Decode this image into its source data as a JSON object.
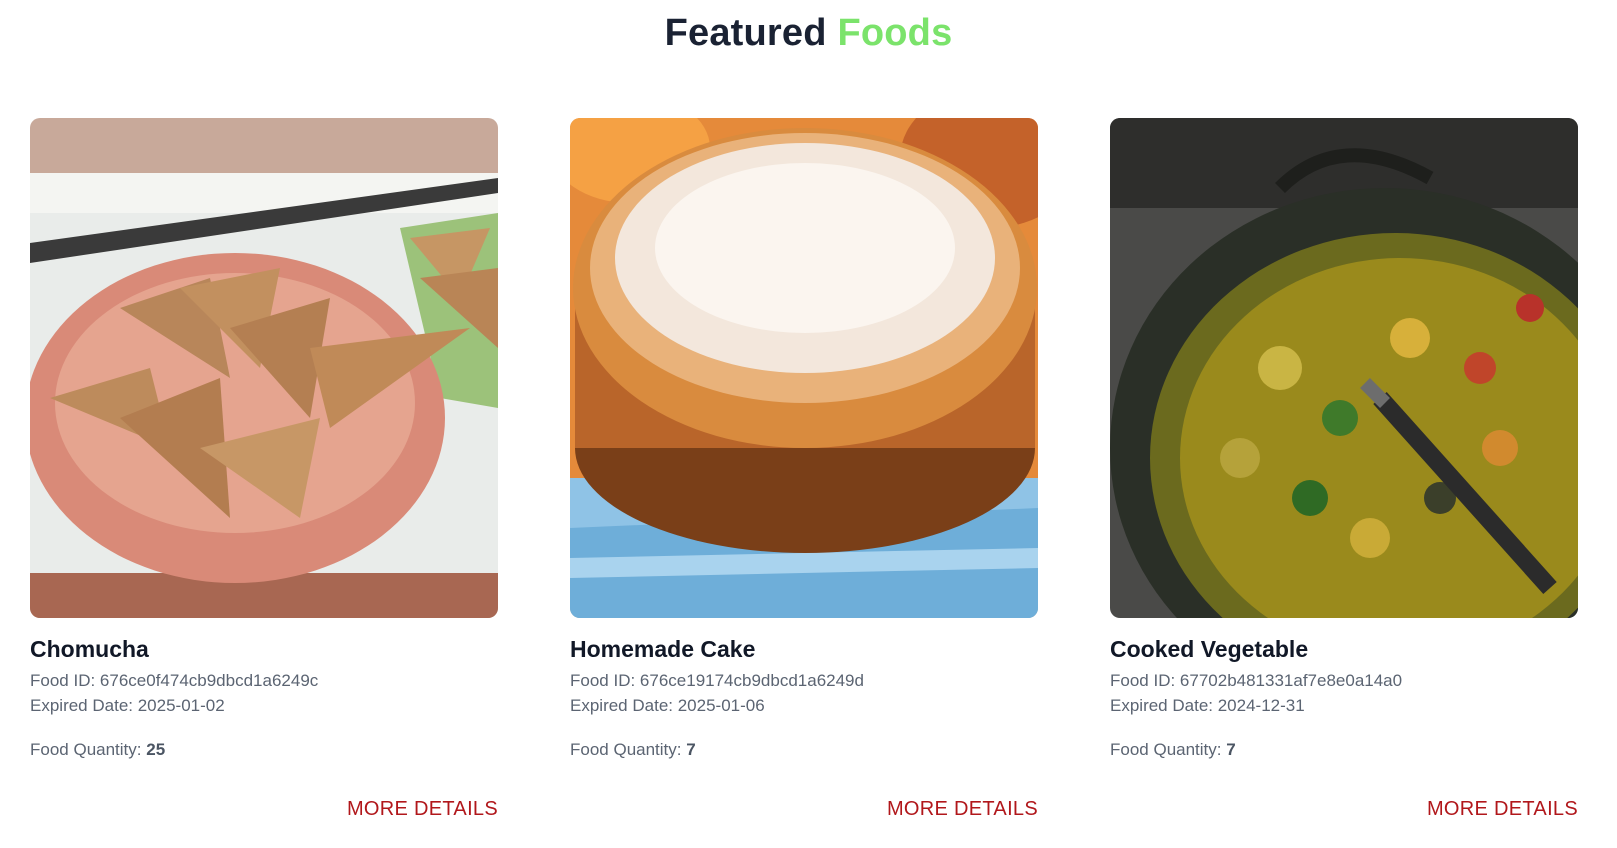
{
  "section": {
    "title_main": "Featured",
    "title_accent": "Foods",
    "accent_color": "#7be36b"
  },
  "foods": [
    {
      "name": "Chomucha",
      "id_label": "Food ID: 676ce0f474cb9dbcd1a6249c",
      "expired_label": "Expired Date: 2025-01-02",
      "quantity_label": "Food Quantity: ",
      "quantity_value": "25",
      "more_label": "MORE DETAILS",
      "image_icon": "samosa-bowl-photo"
    },
    {
      "name": "Homemade Cake",
      "id_label": "Food ID: 676ce19174cb9dbcd1a6249d",
      "expired_label": "Expired Date: 2025-01-06",
      "quantity_label": "Food Quantity: ",
      "quantity_value": "7",
      "more_label": "MORE DETAILS",
      "image_icon": "sponge-cake-photo"
    },
    {
      "name": "Cooked Vegetable",
      "id_label": "Food ID: 67702b481331af7e8e0a14a0",
      "expired_label": "Expired Date: 2024-12-31",
      "quantity_label": "Food Quantity: ",
      "quantity_value": "7",
      "more_label": "MORE DETAILS",
      "image_icon": "vegetable-curry-pot-photo"
    }
  ],
  "link_color": "#b1171b"
}
